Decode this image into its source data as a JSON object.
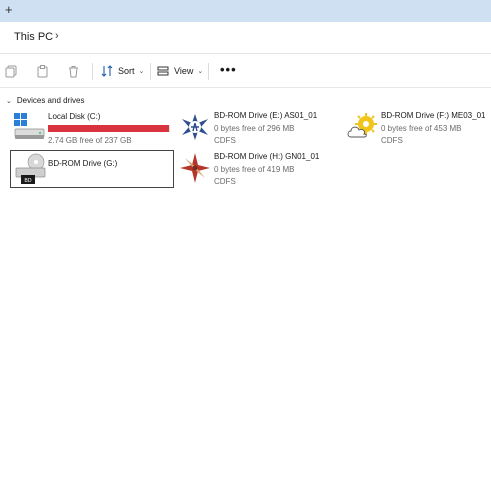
{
  "tabstrip": {
    "new_tab_symbol": "+"
  },
  "address": {
    "crumb": "This PC",
    "separator": "›"
  },
  "toolbar": {
    "sort_label": "Sort",
    "view_label": "View",
    "more_label": "•••",
    "dropdown_symbol": "⌄"
  },
  "section": {
    "title": "Devices and drives",
    "caret": "⌄"
  },
  "drives": [
    {
      "name": "Local Disk (C:)",
      "detail": "2.74 GB free of 237 GB",
      "used_fraction": 0.988
    },
    {
      "name": "BD-ROM Drive (E:) AS01_01",
      "detail": "0 bytes free of 296 MB",
      "fs": "CDFS"
    },
    {
      "name": "BD-ROM Drive (F:) ME03_01",
      "detail": "0 bytes free of 453 MB",
      "fs": "CDFS"
    },
    {
      "name": "BD-ROM Drive (G:)",
      "badge": "BD"
    },
    {
      "name": "BD-ROM Drive (H:) GN01_01",
      "detail": "0 bytes free of 419 MB",
      "fs": "CDFS"
    }
  ],
  "colors": {
    "capacity_bar_full": "#d9333f",
    "tab_strip": "#cfe0f3"
  }
}
